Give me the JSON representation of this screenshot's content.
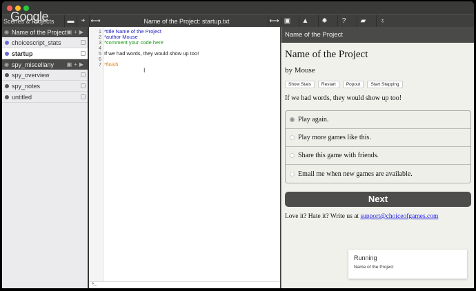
{
  "watermark": "Google",
  "sidebar": {
    "title": "Scenes & Projects",
    "groups": [
      {
        "name": "Name of the Project",
        "items": [
          {
            "label": "choicescript_stats",
            "color": "#6b6bd6"
          },
          {
            "label": "startup",
            "color": "#6b6bd6",
            "selected": true
          }
        ]
      },
      {
        "name": "spy_miscellany",
        "items": [
          {
            "label": "spy_overview",
            "color": "#555"
          },
          {
            "label": "spy_notes",
            "color": "#555"
          },
          {
            "label": "untitled",
            "color": "#555"
          }
        ]
      }
    ]
  },
  "editor": {
    "file_title": "Name of the Project: startup.txt",
    "lines": [
      {
        "n": "1",
        "text": "*title Name of the Project",
        "color": "#2020c0"
      },
      {
        "n": "2",
        "text": "*author Mouse",
        "color": "#2020c0"
      },
      {
        "n": "3",
        "text": "*comment your code here",
        "color": "#1a9a1a"
      },
      {
        "n": "4",
        "text": "",
        "color": "#222"
      },
      {
        "n": "5",
        "text": "If we had words, they would show up too!",
        "color": "#222"
      },
      {
        "n": "6",
        "text": "",
        "color": "#222"
      },
      {
        "n": "7",
        "text": "*finish",
        "color": "#e07a10"
      }
    ],
    "console_prompt": ">_"
  },
  "toolbar_icons": [
    "folder-icon",
    "plus-icon",
    "expand-icon",
    "expand-icon",
    "cube-icon",
    "warning-icon",
    "gear-icon",
    "help-icon",
    "book-icon",
    "lightbulb-icon"
  ],
  "preview": {
    "header": "Name of the Project",
    "title": "Name of the Project",
    "author": "by Mouse",
    "buttons": [
      "Show Stats",
      "Restart",
      "Popout",
      "Start Stepping"
    ],
    "text": "If we had words, they would show up too!",
    "choices": [
      "Play again.",
      "Play more games like this.",
      "Share this game with friends.",
      "Email me when new games are available."
    ],
    "selected_choice": 0,
    "next": "Next",
    "love_text": "Love it? Hate it? Write us at ",
    "email": "support@choiceofgames.com"
  },
  "toast": {
    "title": "Running",
    "subtitle": "Name of the Project"
  }
}
